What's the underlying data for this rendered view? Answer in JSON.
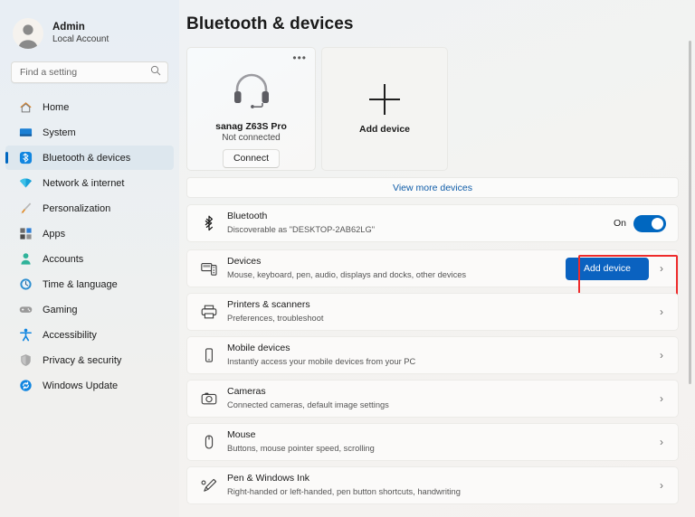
{
  "account": {
    "name": "Admin",
    "subtitle": "Local Account",
    "avatar_icon": "person-avatar-icon"
  },
  "search": {
    "placeholder": "Find a setting",
    "value": "",
    "icon": "search-icon"
  },
  "sidebar": {
    "items": [
      {
        "label": "Home",
        "icon": "home-icon",
        "selected": false
      },
      {
        "label": "System",
        "icon": "monitor-icon",
        "selected": false
      },
      {
        "label": "Bluetooth & devices",
        "icon": "bluetooth-icon",
        "selected": true
      },
      {
        "label": "Network & internet",
        "icon": "wifi-icon",
        "selected": false
      },
      {
        "label": "Personalization",
        "icon": "paintbrush-icon",
        "selected": false
      },
      {
        "label": "Apps",
        "icon": "apps-grid-icon",
        "selected": false
      },
      {
        "label": "Accounts",
        "icon": "person-icon",
        "selected": false
      },
      {
        "label": "Time & language",
        "icon": "clock-icon",
        "selected": false
      },
      {
        "label": "Gaming",
        "icon": "gamepad-icon",
        "selected": false
      },
      {
        "label": "Accessibility",
        "icon": "accessibility-person-icon",
        "selected": false
      },
      {
        "label": "Privacy & security",
        "icon": "shield-icon",
        "selected": false
      },
      {
        "label": "Windows Update",
        "icon": "update-refresh-icon",
        "selected": false
      }
    ]
  },
  "page": {
    "title": "Bluetooth & devices"
  },
  "device_card": {
    "name": "sanag Z63S Pro",
    "status": "Not connected",
    "connect_label": "Connect",
    "overflow_icon": "more-options-icon",
    "device_icon": "headphones-icon"
  },
  "add_card": {
    "label": "Add device",
    "icon": "plus-icon"
  },
  "view_more": {
    "label": "View more devices"
  },
  "bluetooth": {
    "title": "Bluetooth",
    "subtitle": "Discoverable as \"DESKTOP-2AB62LG\"",
    "toggle_state": "On",
    "icon": "bluetooth-icon",
    "accent_color": "#0067c0"
  },
  "settings_rows": [
    {
      "title": "Devices",
      "subtitle": "Mouse, keyboard, pen, audio, displays and docks, other devices",
      "icon": "devices-icon",
      "button_label": "Add device",
      "has_button": true,
      "highlighted": true
    },
    {
      "title": "Printers & scanners",
      "subtitle": "Preferences, troubleshoot",
      "icon": "printer-icon",
      "has_button": false,
      "highlighted": false
    },
    {
      "title": "Mobile devices",
      "subtitle": "Instantly access your mobile devices from your PC",
      "icon": "phone-icon",
      "has_button": false,
      "highlighted": false
    },
    {
      "title": "Cameras",
      "subtitle": "Connected cameras, default image settings",
      "icon": "camera-icon",
      "has_button": false,
      "highlighted": false
    },
    {
      "title": "Mouse",
      "subtitle": "Buttons, mouse pointer speed, scrolling",
      "icon": "mouse-icon",
      "has_button": false,
      "highlighted": false
    },
    {
      "title": "Pen & Windows Ink",
      "subtitle": "Right-handed or left-handed, pen button shortcuts, handwriting",
      "icon": "pen-icon",
      "has_button": false,
      "highlighted": false
    }
  ],
  "chevron_glyph": "›",
  "colors": {
    "accent_blue": "#0067c0",
    "button_blue": "#0a62c0",
    "link_blue": "#0f5ca8",
    "highlight_red": "#ee2b2b",
    "sidebar_selected": "#dde7ee"
  }
}
